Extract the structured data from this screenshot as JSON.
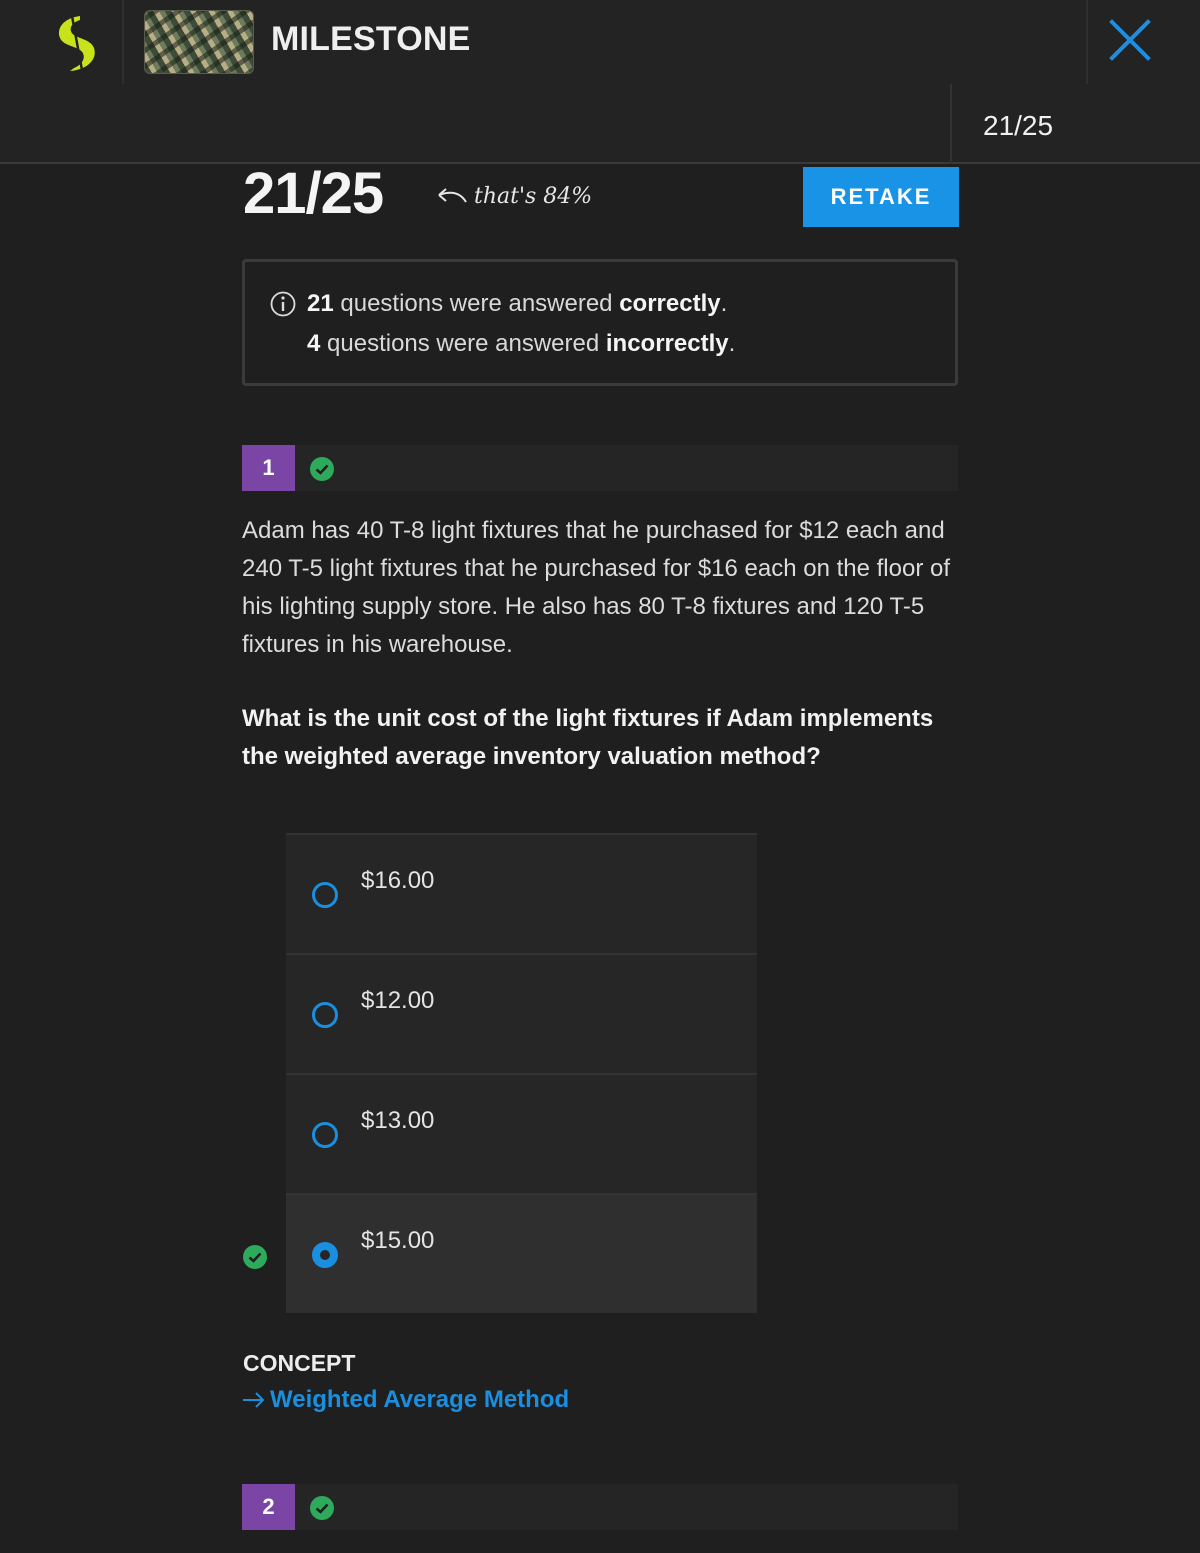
{
  "header": {
    "title": "MILESTONE",
    "logo_icon": "sophia-logo-icon",
    "thumbnail": "course-thumbnail",
    "close_icon": "close-icon",
    "accent_color": "#c8e31b",
    "close_color": "#1f8ee0"
  },
  "progress": {
    "count": "21/25"
  },
  "result": {
    "score": "21/25",
    "note": "that's 84%",
    "retake_label": "RETAKE",
    "retake_color": "#1993e6",
    "summary": {
      "correct_count": "21",
      "correct_text": " questions were answered ",
      "correct_word": "correctly",
      "correct_end": ".",
      "incorrect_count": "4",
      "incorrect_text": " questions were answered ",
      "incorrect_word": "incorrectly",
      "incorrect_end": "."
    }
  },
  "questions": [
    {
      "number": "1",
      "status": "correct",
      "text": "Adam has 40 T-8 light fixtures that he purchased for $12 each and 240 T-5 light fixtures that he purchased for $16 each on the floor of his lighting supply store. He also has 80 T-8 fixtures and 120 T-5 fixtures in his warehouse.",
      "prompt": "What is the unit cost of the light fixtures if Adam implements the weighted average inventory valuation method?",
      "choices": [
        {
          "label": "$16.00",
          "selected": false
        },
        {
          "label": "$12.00",
          "selected": false
        },
        {
          "label": "$13.00",
          "selected": false
        },
        {
          "label": "$15.00",
          "selected": true,
          "correct": true
        }
      ],
      "concept_heading": "CONCEPT",
      "concept_link": "Weighted Average Method"
    },
    {
      "number": "2",
      "status": "correct"
    }
  ]
}
